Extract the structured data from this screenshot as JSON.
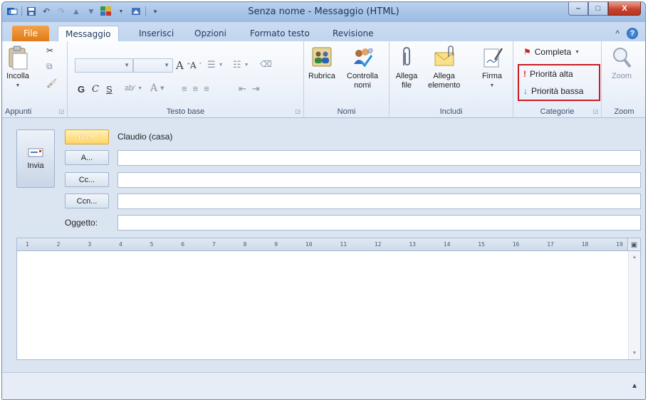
{
  "window": {
    "title": "Senza nome - Messaggio (HTML)",
    "buttons": {
      "minimize": "–",
      "maximize": "□",
      "close": "X"
    }
  },
  "tabs": [
    {
      "label": "File"
    },
    {
      "label": "Messaggio"
    },
    {
      "label": "Inserisci"
    },
    {
      "label": "Opzioni"
    },
    {
      "label": "Formato testo"
    },
    {
      "label": "Revisione"
    }
  ],
  "help": {
    "collapse": "^",
    "help": "?"
  },
  "ribbon": {
    "appunti": {
      "group_label": "Appunti",
      "paste_label": "Incolla"
    },
    "testo_base": {
      "group_label": "Testo base",
      "grow_font": "A",
      "shrink_font": "A",
      "bold": "G",
      "italic": "C",
      "underline": "S",
      "font_color": "A"
    },
    "nomi": {
      "group_label": "Nomi",
      "rubrica": "Rubrica",
      "controlla_nomi_1": "Controlla",
      "controlla_nomi_2": "nomi"
    },
    "includi": {
      "group_label": "Includi",
      "allega_file_1": "Allega",
      "allega_file_2": "file",
      "allega_elemento_1": "Allega",
      "allega_elemento_2": "elemento",
      "firma": "Firma"
    },
    "categorie": {
      "group_label": "Categorie",
      "completa": "Completa",
      "priorita_alta": "Priorità alta",
      "priorita_bassa": "Priorità bassa",
      "highlight_color": "#c81d25"
    },
    "zoom": {
      "group_label": "Zoom",
      "zoom_label": "Zoom"
    }
  },
  "form": {
    "send_label": "Invia",
    "from_button": "Da",
    "from_value": "Claudio (casa)",
    "to_button": "A...",
    "cc_button": "Cc...",
    "bcc_button": "Ccn...",
    "subject_label": "Oggetto:",
    "to_value": "",
    "cc_value": "",
    "bcc_value": "",
    "subject_value": ""
  },
  "ruler": {
    "marks": [
      "1",
      "2",
      "3",
      "4",
      "5",
      "6",
      "7",
      "8",
      "9",
      "10",
      "11",
      "12",
      "13",
      "14",
      "15",
      "16",
      "17",
      "18",
      "19"
    ]
  },
  "colors": {
    "file_tab": "#e07a15",
    "ribbon_bg": "#eef3fa",
    "form_bg": "#dbe5f2",
    "from_button": "#ffd466"
  }
}
